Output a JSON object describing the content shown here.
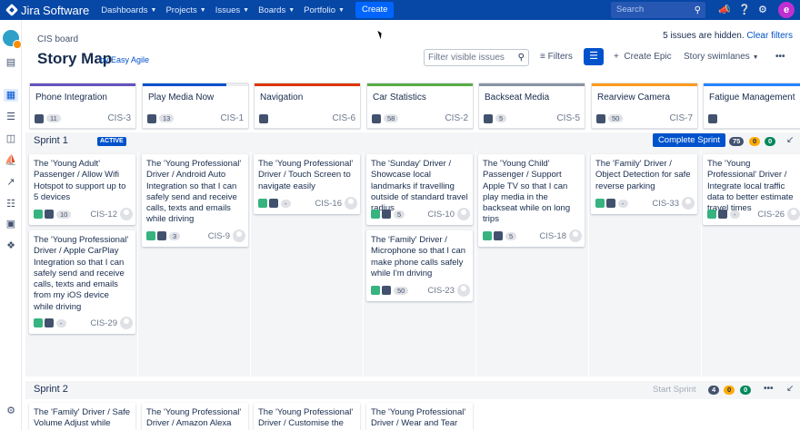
{
  "topnav": {
    "app_name": "Jira",
    "app_name2": "Software",
    "menu": [
      "Dashboards",
      "Projects",
      "Issues",
      "Boards",
      "Portfolio"
    ],
    "create_label": "Create",
    "search_placeholder": "Search",
    "icons": [
      "megaphone-icon",
      "help-icon",
      "settings-icon"
    ],
    "avatar_letter": "e"
  },
  "header": {
    "breadcrumb": "CIS board",
    "title": "Story Map",
    "by": "by Easy Agile",
    "hidden_text": "5 issues are hidden.",
    "clear_filters": "Clear filters",
    "filter_placeholder": "Filter visible issues",
    "filters_label": "Filters",
    "create_epic_label": "Create Epic",
    "swimlanes_label": "Story swimlanes"
  },
  "epics": [
    {
      "title": "Phone Integration",
      "color": "#6554c0",
      "pill": "11",
      "key": "CIS-3"
    },
    {
      "title": "Play Media Now",
      "color": "#0052cc",
      "progress": 0.78,
      "pill": "13",
      "key": "CIS-1"
    },
    {
      "title": "Navigation",
      "color": "#de350b",
      "pill": "",
      "key": "CIS-6"
    },
    {
      "title": "Car Statistics",
      "color": "#5aac44",
      "pill": "58",
      "key": "CIS-2"
    },
    {
      "title": "Backseat Media",
      "color": "#8993a4",
      "pill": "5",
      "key": "CIS-5"
    },
    {
      "title": "Rearview Camera",
      "color": "#ff991f",
      "pill": "50",
      "key": "CIS-7"
    },
    {
      "title": "Fatigue Management",
      "color": "#2684ff",
      "pill": "",
      "key": ""
    }
  ],
  "sprint1": {
    "name": "Sprint 1",
    "status": "ACTIVE",
    "button": "Complete Sprint",
    "counts": [
      "75",
      "0",
      "0"
    ]
  },
  "sprint2": {
    "name": "Sprint 2",
    "button": "Start Sprint",
    "counts": [
      "4",
      "0",
      "0"
    ]
  },
  "cards": [
    {
      "text": "The 'Young Adult' Passenger / Allow Wifi Hotspot to support up to 5 devices",
      "pill": "10",
      "key": "CIS-12",
      "flag": true
    },
    {
      "text": "The 'Young Professional' Driver / Apple CarPlay Integration so that I can safely send and receive calls, texts and emails from my iOS device while driving",
      "pill": "-",
      "key": "CIS-29",
      "flag": true
    },
    {
      "text": "The 'Young Professional' Driver / Android Auto Integration so that I can safely send and receive calls, texts and emails while driving",
      "pill": "3",
      "key": "CIS-9",
      "flag": true
    },
    {
      "text": "The 'Young Professional' Driver / Touch Screen to navigate easily",
      "pill": "-",
      "key": "CIS-16",
      "flag": true
    },
    {
      "text": "The 'Sunday' Driver / Showcase local landmarks if travelling outside of standard travel radius",
      "pill": "5",
      "key": "CIS-10",
      "flag": true
    },
    {
      "text": "The 'Family' Driver / Microphone so that I can make phone calls safely while I'm driving",
      "pill": "50",
      "key": "CIS-23",
      "flag": true
    },
    {
      "text": "The 'Young Child' Passenger / Support Apple TV so that I can play media in the backseat while on long trips",
      "pill": "5",
      "key": "CIS-18",
      "flag": true
    },
    {
      "text": "The 'Family' Driver / Object Detection for safe reverse parking",
      "pill": "-",
      "key": "CIS-33",
      "flag": true
    },
    {
      "text": "The 'Young Professional' Driver / Integrate local traffic data to better estimate travel times",
      "pill": "-",
      "key": "CIS-26",
      "flag": true
    },
    {
      "text": "The 'Family' Driver / Safe Volume Adjust while",
      "pill": "",
      "key": "",
      "flag": false
    },
    {
      "text": "The 'Young Professional' Driver / Amazon Alexa",
      "pill": "",
      "key": "",
      "flag": false
    },
    {
      "text": "The 'Young Professional' Driver / Customise the",
      "pill": "",
      "key": "",
      "flag": false
    },
    {
      "text": "The 'Young Professional' Driver / Wear and Tear",
      "pill": "",
      "key": "",
      "flag": false
    }
  ]
}
